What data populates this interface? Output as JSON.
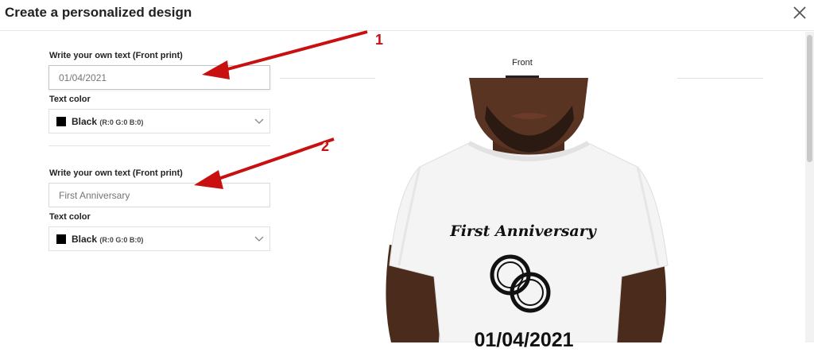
{
  "dialog": {
    "title": "Create a personalized design",
    "close_icon": "close-icon"
  },
  "form": {
    "field1": {
      "label": "Write your own text (Front print)",
      "value": "01/04/2021"
    },
    "color1": {
      "label": "Text color",
      "selected": "Black",
      "sub": "(R:0 G:0 B:0)",
      "swatch": "#000000"
    },
    "field2": {
      "label": "Write your own text (Front print)",
      "value": "First Anniversary"
    },
    "color2": {
      "label": "Text color",
      "selected": "Black",
      "sub": "(R:0 G:0 B:0)",
      "swatch": "#000000"
    }
  },
  "preview": {
    "tab": "Front",
    "shirt_title": "First Anniversary",
    "shirt_date": "01/04/2021"
  },
  "annotations": {
    "marker1": "1",
    "marker2": "2",
    "color": "#c81010"
  }
}
